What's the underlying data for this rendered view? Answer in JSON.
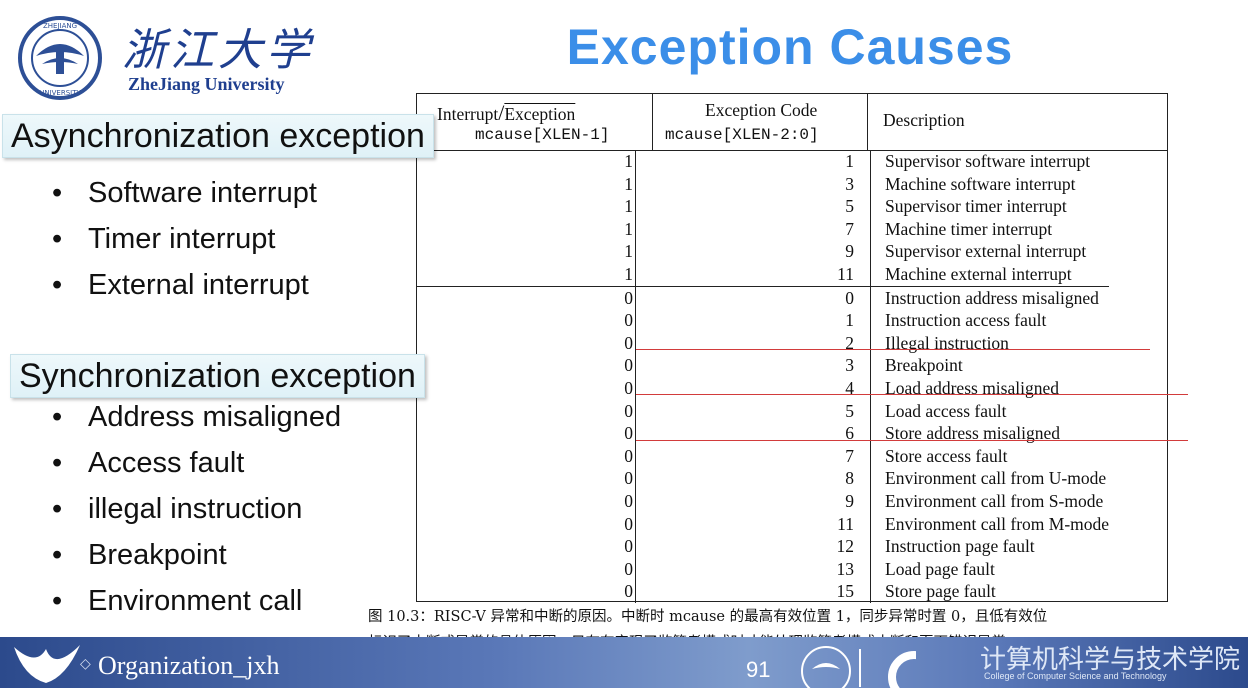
{
  "header": {
    "logo_cn": "浙江大学",
    "logo_en": "ZheJiang University",
    "title": "Exception  Causes"
  },
  "left": {
    "async_heading": "Asynchronization exception",
    "async_items": [
      "Software interrupt",
      "Timer interrupt",
      "External interrupt"
    ],
    "sync_heading": "Synchronization exception",
    "sync_items": [
      "Address misaligned",
      "Access fault",
      "illegal instruction",
      "Breakpoint",
      "Environment call"
    ]
  },
  "table": {
    "headers": {
      "col1_line1_a": "Interrupt",
      "col1_line1_b": "Exception",
      "col1_line2": "mcause[XLEN-1]",
      "col2_line1": "Exception Code",
      "col2_line2": "mcause[XLEN-2:0]",
      "col3": "Description"
    },
    "rows": [
      {
        "interrupt": "1",
        "code": "1",
        "desc": "Supervisor software interrupt"
      },
      {
        "interrupt": "1",
        "code": "3",
        "desc": "Machine software interrupt"
      },
      {
        "interrupt": "1",
        "code": "5",
        "desc": "Supervisor timer interrupt"
      },
      {
        "interrupt": "1",
        "code": "7",
        "desc": "Machine timer interrupt"
      },
      {
        "interrupt": "1",
        "code": "9",
        "desc": "Supervisor external interrupt"
      },
      {
        "interrupt": "1",
        "code": "11",
        "desc": "Machine external interrupt"
      },
      {
        "interrupt": "0",
        "code": "0",
        "desc": "Instruction address misaligned"
      },
      {
        "interrupt": "0",
        "code": "1",
        "desc": "Instruction access fault"
      },
      {
        "interrupt": "0",
        "code": "2",
        "desc": "Illegal instruction"
      },
      {
        "interrupt": "0",
        "code": "3",
        "desc": "Breakpoint"
      },
      {
        "interrupt": "0",
        "code": "4",
        "desc": "Load address misaligned"
      },
      {
        "interrupt": "0",
        "code": "5",
        "desc": "Load access fault"
      },
      {
        "interrupt": "0",
        "code": "6",
        "desc": "Store address misaligned"
      },
      {
        "interrupt": "0",
        "code": "7",
        "desc": "Store access fault"
      },
      {
        "interrupt": "0",
        "code": "8",
        "desc": "Environment call from U-mode"
      },
      {
        "interrupt": "0",
        "code": "9",
        "desc": "Environment call from S-mode"
      },
      {
        "interrupt": "0",
        "code": "11",
        "desc": "Environment call from M-mode"
      },
      {
        "interrupt": "0",
        "code": "12",
        "desc": "Instruction page fault"
      },
      {
        "interrupt": "0",
        "code": "13",
        "desc": "Load page fault"
      },
      {
        "interrupt": "0",
        "code": "15",
        "desc": "Store page fault"
      }
    ]
  },
  "caption": {
    "line1": "图 10.3：RISC-V 异常和中断的原因。中断时 mcause 的最高有效位置 1，同步异常时置 0，且低有效位",
    "line2": "标识了中断或异常的具体原因。只有在实现了监管者模式时才能处理监管者模式中断和页面错误异常"
  },
  "footer": {
    "org": "Organization_jxh",
    "page": "91",
    "college_cn": "计算机科学与技术学院",
    "college_en": "College of Computer Science and Technology"
  },
  "colors": {
    "title": "#3b8ee8",
    "underline": "#d23b3b",
    "footer": "#4a68a8"
  }
}
